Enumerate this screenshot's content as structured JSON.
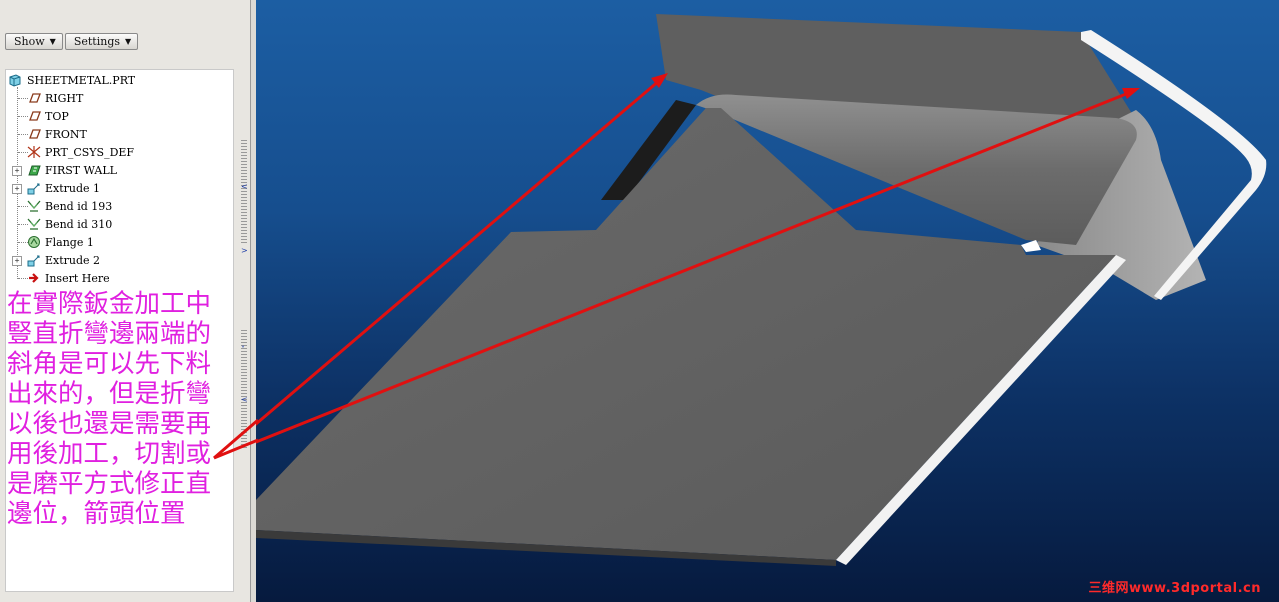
{
  "toolbar": {
    "show_label": "Show",
    "settings_label": "Settings"
  },
  "model_tree": {
    "root": "SHEETMETAL.PRT",
    "items": [
      {
        "label": "RIGHT",
        "icon": "datum-plane-icon",
        "expandable": false
      },
      {
        "label": "TOP",
        "icon": "datum-plane-icon",
        "expandable": false
      },
      {
        "label": "FRONT",
        "icon": "datum-plane-icon",
        "expandable": false
      },
      {
        "label": "PRT_CSYS_DEF",
        "icon": "coordinate-system-icon",
        "expandable": false
      },
      {
        "label": "FIRST WALL",
        "icon": "first-wall-icon",
        "expandable": true
      },
      {
        "label": "Extrude 1",
        "icon": "extrude-icon",
        "expandable": true
      },
      {
        "label": "Bend id 193",
        "icon": "bend-icon",
        "expandable": false
      },
      {
        "label": "Bend id 310",
        "icon": "bend-icon",
        "expandable": false
      },
      {
        "label": "Flange 1",
        "icon": "flange-icon",
        "expandable": false
      },
      {
        "label": "Extrude 2",
        "icon": "extrude-icon",
        "expandable": true
      },
      {
        "label": "Insert Here",
        "icon": "insert-here-arrow-icon",
        "expandable": false
      }
    ]
  },
  "annotation": {
    "text": "在實際鈑金加工中豎直折彎邊兩端的斜角是可以先下料出來的，但是折彎以後也還是需要再用後加工，切割或是磨平方式修正直邊位，箭頭位置",
    "color": "#e020e0"
  },
  "viewport": {
    "background_top": "#1c5ea3",
    "background_bottom": "#061a3e",
    "part_color": "#646464",
    "arrow_color": "#e01010"
  },
  "watermark": {
    "text": "三维网www.3dportal.cn"
  }
}
